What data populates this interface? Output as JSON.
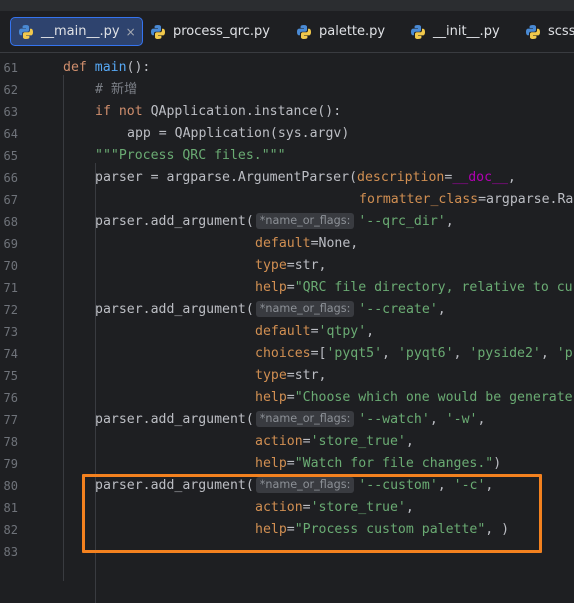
{
  "colors": {
    "background": "#1e1f22",
    "tab_active_bg": "#2e436e",
    "tab_active_border": "#3574f0",
    "keyword": "#cf8e6d",
    "function": "#56a8f5",
    "string": "#6aab73",
    "comment": "#7a7e85",
    "keyword_argument": "#d18f52",
    "dunder": "#b200b2",
    "highlight_box": "#f3811f"
  },
  "tabs": [
    {
      "label": "__main__.py",
      "icon": "python-file-icon",
      "active": true,
      "close": "×"
    },
    {
      "label": "process_qrc.py",
      "icon": "python-file-icon",
      "active": false
    },
    {
      "label": "palette.py",
      "icon": "python-file-icon",
      "active": false
    },
    {
      "label": "__init__.py",
      "icon": "python-file-icon",
      "active": false
    },
    {
      "label": "scss.",
      "icon": "python-file-icon",
      "active": false
    }
  ],
  "inlay_hint": "*name_or_flags:",
  "editor": {
    "lines": [
      {
        "n": "61",
        "t": {
          "a": "def",
          "b": " ",
          "c": "main",
          "d": "():"
        }
      },
      {
        "n": "62",
        "t": {
          "a": "# 新增"
        }
      },
      {
        "n": "63",
        "t": {
          "a": "if not",
          "b": " QApplication.instance():"
        }
      },
      {
        "n": "64",
        "t": {
          "a": "app = QApplication(sys.argv)"
        }
      },
      {
        "n": "65",
        "t": {
          "a": "\"\"\"Process QRC files.\"\"\""
        }
      },
      {
        "n": "66",
        "t": {
          "a": "parser = argparse.ArgumentParser(",
          "b": "description",
          "c": "=",
          "d": "__doc__",
          "e": ","
        }
      },
      {
        "n": "67",
        "t": {
          "a": "formatter_class",
          "b": "=argparse.Ra"
        }
      },
      {
        "n": "68",
        "t": {
          "a": "parser.add_argument(",
          "b": "'--qrc_dir'",
          "c": ","
        }
      },
      {
        "n": "69",
        "t": {
          "a": "default",
          "b": "=None,"
        }
      },
      {
        "n": "70",
        "t": {
          "a": "type",
          "b": "=str,"
        }
      },
      {
        "n": "71",
        "t": {
          "a": "help",
          "b": "=",
          "c": "\"QRC file directory, relative to cu"
        }
      },
      {
        "n": "72",
        "t": {
          "a": "parser.add_argument(",
          "b": "'--create'",
          "c": ","
        }
      },
      {
        "n": "73",
        "t": {
          "a": "default",
          "b": "=",
          "c": "'qtpy'",
          "d": ","
        }
      },
      {
        "n": "74",
        "t": {
          "a": "choices",
          "b": "=[",
          "c": "'pyqt5'",
          "d": ", ",
          "e": "'pyqt6'",
          "f": ", ",
          "g": "'pyside2'",
          "h": ", ",
          "i": "'p"
        }
      },
      {
        "n": "75",
        "t": {
          "a": "type",
          "b": "=str,"
        }
      },
      {
        "n": "76",
        "t": {
          "a": "help",
          "b": "=",
          "c": "\"Choose which one would be generate"
        }
      },
      {
        "n": "77",
        "t": {
          "a": "parser.add_argument(",
          "b": "'--watch'",
          "c": ", ",
          "d": "'-w'",
          "e": ","
        }
      },
      {
        "n": "78",
        "t": {
          "a": "action",
          "b": "=",
          "c": "'store_true'",
          "d": ","
        }
      },
      {
        "n": "79",
        "t": {
          "a": "help",
          "b": "=",
          "c": "\"Watch for file changes.\"",
          "d": ")"
        }
      },
      {
        "n": "80",
        "t": {
          "a": "parser.add_argument(",
          "b": "'--custom'",
          "c": ", ",
          "d": "'-c'",
          "e": ","
        }
      },
      {
        "n": "81",
        "t": {
          "a": "action",
          "b": "=",
          "c": "'store_true'",
          "d": ","
        }
      },
      {
        "n": "82",
        "t": {
          "a": "help",
          "b": "=",
          "c": "\"Process custom palette\"",
          "d": ", )"
        }
      },
      {
        "n": "83",
        "t": {}
      }
    ]
  }
}
